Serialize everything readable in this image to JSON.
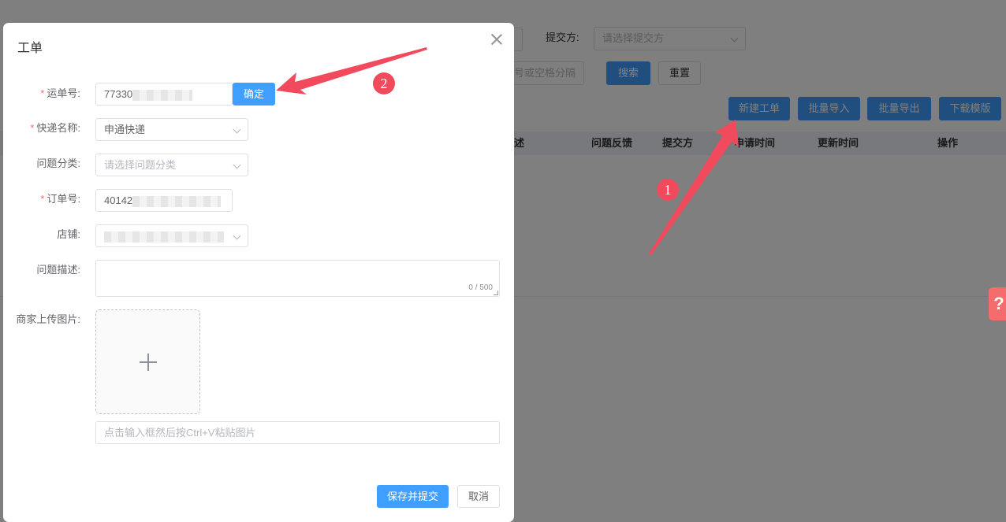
{
  "background": {
    "filters": {
      "submitter_label": "提交方:",
      "submitter_placeholder": "请选择提交方",
      "partial_hint": "号或空格分隔",
      "search_button": "搜索",
      "reset_button": "重置"
    },
    "toolbar": {
      "new_ticket": "新建工单",
      "batch_import": "批量导入",
      "batch_export": "批量导出",
      "download_template": "下载模版"
    },
    "table_headers": [
      "述",
      "问题反馈",
      "提交方",
      "申请时间",
      "更新时间",
      "操作"
    ],
    "help_icon": "?"
  },
  "dialog": {
    "title": "工单",
    "fields": {
      "waybill": {
        "label": "运单号:",
        "value": "77330",
        "confirm": "确定"
      },
      "courier": {
        "label": "快递名称:",
        "value": "申通快递"
      },
      "category": {
        "label": "问题分类:",
        "placeholder": "请选择问题分类"
      },
      "order": {
        "label": "订单号:",
        "value": "40142"
      },
      "shop": {
        "label": "店铺:"
      },
      "description": {
        "label": "问题描述:",
        "counter": "0 / 500"
      },
      "images": {
        "label": "商家上传图片:",
        "paste_placeholder": "点击输入框然后按Ctrl+V粘贴图片"
      }
    },
    "required_mark": "*",
    "save_button": "保存并提交",
    "cancel_button": "取消"
  },
  "annotations": {
    "step1": "1",
    "step2": "2",
    "color": "#f24a5d"
  },
  "colors": {
    "primary": "#409eff",
    "overlay": "rgba(0,0,0,0.5)",
    "help_tab": "#f56c6c"
  }
}
